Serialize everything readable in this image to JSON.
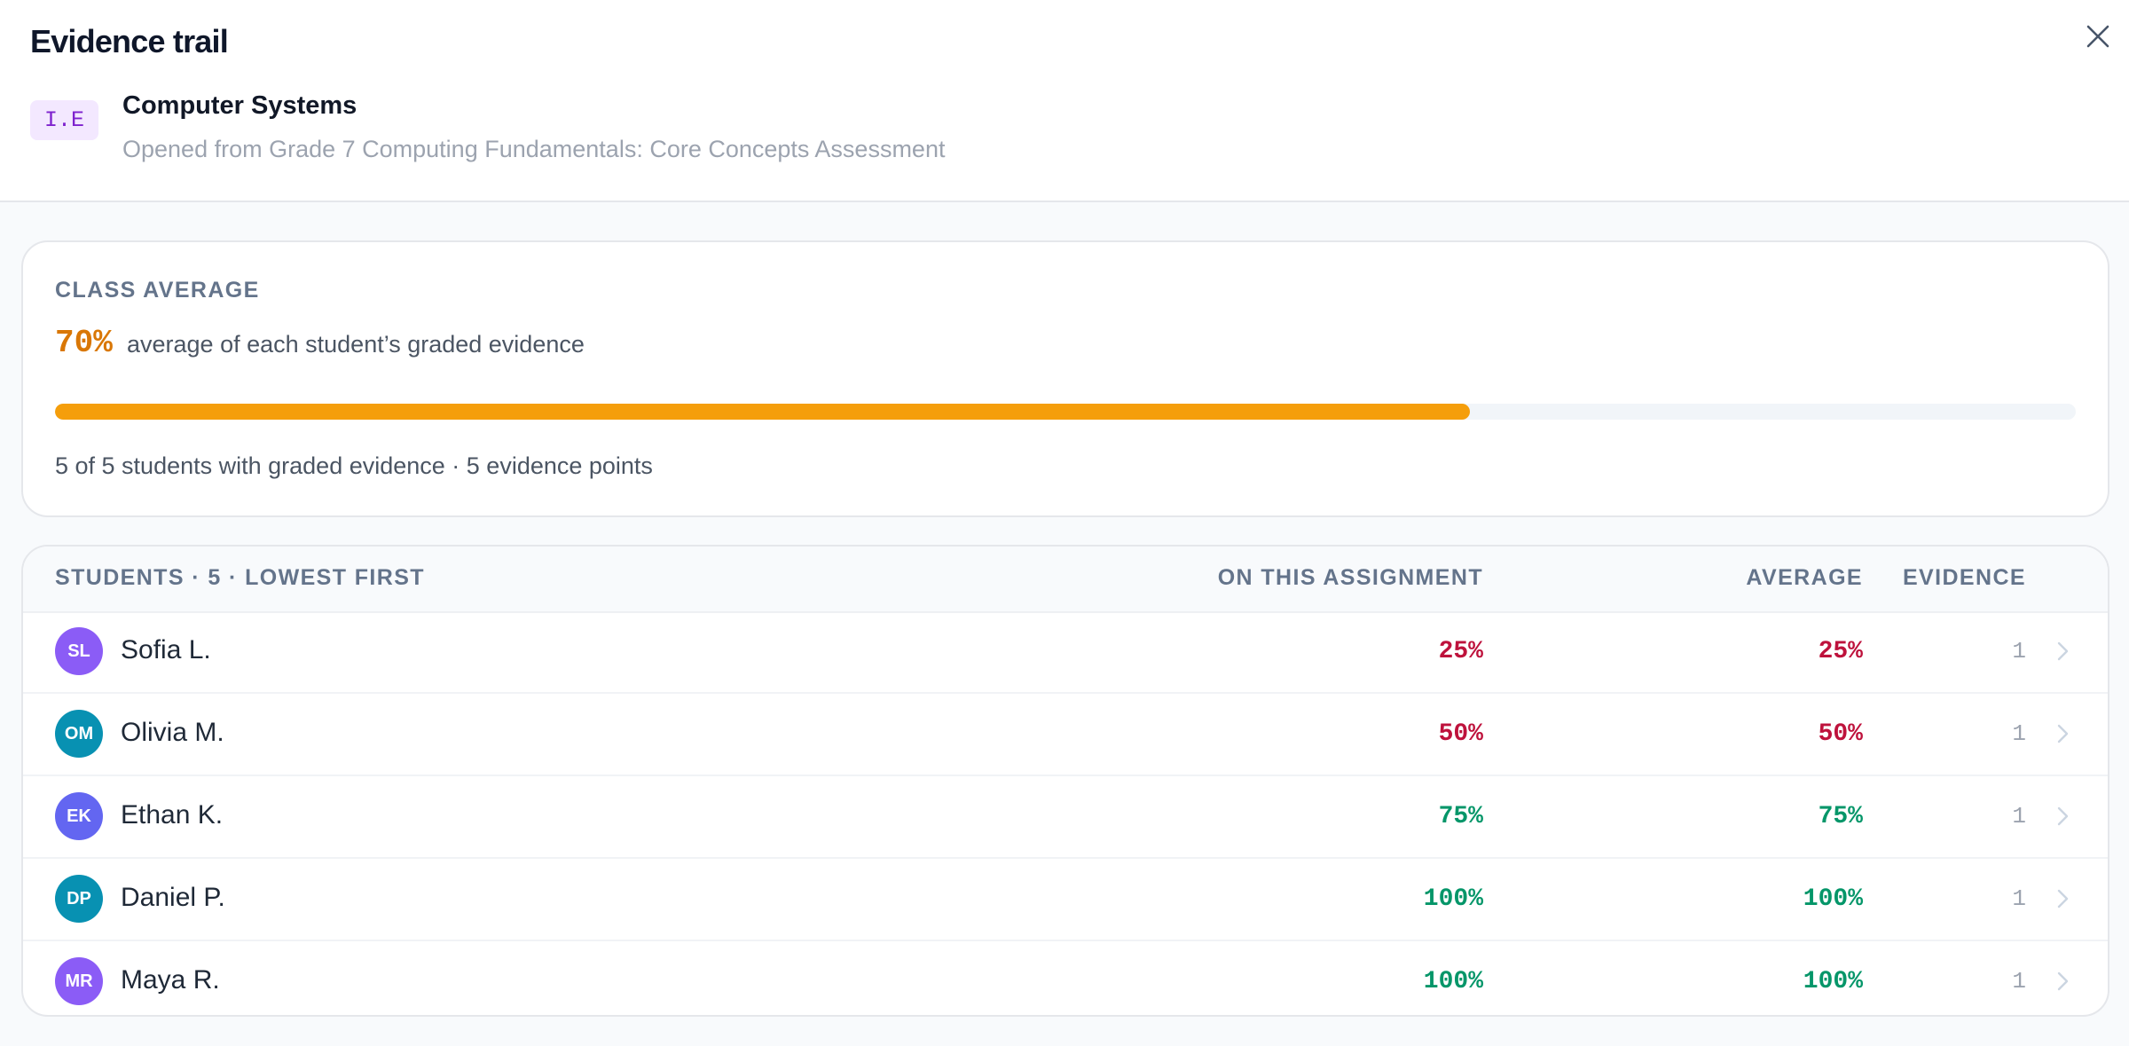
{
  "header": {
    "title": "Evidence trail",
    "code": "I.E",
    "skill_name": "Computer Systems",
    "source": "Opened from Grade 7 Computing Fundamentals: Core Concepts Assessment",
    "close_icon": "close-icon"
  },
  "class_average": {
    "label": "CLASS AVERAGE",
    "value": "70%",
    "progress_percent": 70,
    "description": "average of each student’s graded evidence",
    "summary": "5 of 5 students with graded evidence · 5 evidence points",
    "accent_color": "#d97706",
    "bar_color": "#f59e0b"
  },
  "table": {
    "headers": {
      "students": "STUDENTS · 5 · LOWEST FIRST",
      "assignment": "ON THIS ASSIGNMENT",
      "average": "AVERAGE",
      "evidence": "EVIDENCE"
    },
    "rows": [
      {
        "initials": "SL",
        "name": "Sofia L.",
        "assignment": "25%",
        "average": "25%",
        "evidence": "1",
        "avatar_color": "#8b5cf6",
        "score_color": "#be123c"
      },
      {
        "initials": "OM",
        "name": "Olivia M.",
        "assignment": "50%",
        "average": "50%",
        "evidence": "1",
        "avatar_color": "#0891b2",
        "score_color": "#be123c"
      },
      {
        "initials": "EK",
        "name": "Ethan K.",
        "assignment": "75%",
        "average": "75%",
        "evidence": "1",
        "avatar_color": "#6366f1",
        "score_color": "#059669"
      },
      {
        "initials": "DP",
        "name": "Daniel P.",
        "assignment": "100%",
        "average": "100%",
        "evidence": "1",
        "avatar_color": "#0891b2",
        "score_color": "#059669"
      },
      {
        "initials": "MR",
        "name": "Maya R.",
        "assignment": "100%",
        "average": "100%",
        "evidence": "1",
        "avatar_color": "#8b5cf6",
        "score_color": "#059669"
      }
    ]
  }
}
